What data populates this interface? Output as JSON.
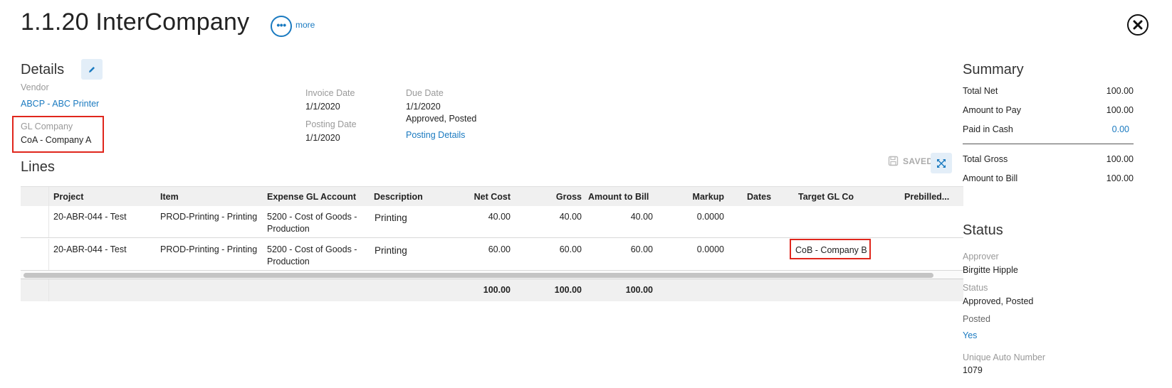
{
  "page": {
    "title": "1.1.20 InterCompany",
    "more_label": "more"
  },
  "details": {
    "heading": "Details",
    "vendor_label": "Vendor",
    "vendor_value": "ABCP - ABC Printer",
    "gl_company_label": "GL Company",
    "gl_company_value": "CoA - Company A",
    "invoice_date_label": "Invoice Date",
    "invoice_date_value": "1/1/2020",
    "posting_date_label": "Posting Date",
    "posting_date_value": "1/1/2020",
    "due_date_label": "Due Date",
    "due_date_value": "1/1/2020",
    "status_text": "Approved, Posted",
    "posting_details_link": "Posting Details"
  },
  "lines": {
    "heading": "Lines",
    "saved_label": "SAVED",
    "columns": [
      "Project",
      "Item",
      "Expense GL Account",
      "Description",
      "Net Cost",
      "Gross",
      "Amount to Bill",
      "Markup",
      "Dates",
      "Target GL Co",
      "Prebilled..."
    ],
    "rows": [
      {
        "project": "20-ABR-044 - Test",
        "item": "PROD-Printing - Printing",
        "expense_gl_line1": "5200 - Cost of Goods -",
        "expense_gl_line2": "Production",
        "description": "Printing",
        "net_cost": "40.00",
        "gross": "40.00",
        "amount_to_bill": "40.00",
        "markup": "0.0000",
        "dates": "",
        "target_gl_co": "",
        "prebilled": ""
      },
      {
        "project": "20-ABR-044 - Test",
        "item": "PROD-Printing - Printing",
        "expense_gl_line1": "5200 - Cost of Goods -",
        "expense_gl_line2": "Production",
        "description": "Printing",
        "net_cost": "60.00",
        "gross": "60.00",
        "amount_to_bill": "60.00",
        "markup": "0.0000",
        "dates": "",
        "target_gl_co": "CoB - Company B",
        "prebilled": ""
      }
    ],
    "totals": {
      "net_cost": "100.00",
      "gross": "100.00",
      "amount_to_bill": "100.00"
    }
  },
  "summary": {
    "heading": "Summary",
    "total_net_label": "Total Net",
    "total_net_value": "100.00",
    "amount_to_pay_label": "Amount to Pay",
    "amount_to_pay_value": "100.00",
    "paid_in_cash_label": "Paid in Cash",
    "paid_in_cash_value": "0.00",
    "total_gross_label": "Total Gross",
    "total_gross_value": "100.00",
    "amount_to_bill_label": "Amount to Bill",
    "amount_to_bill_value": "100.00"
  },
  "status": {
    "heading": "Status",
    "approver_label": "Approver",
    "approver_value": "Birgitte Hipple",
    "status_label": "Status",
    "status_value": "Approved, Posted",
    "posted_label": "Posted",
    "posted_value": "Yes",
    "auto_number_label": "Unique Auto Number",
    "auto_number_value": "1079"
  },
  "colors": {
    "accent": "#1a7ac0",
    "highlight_border": "#e0261c",
    "header_bg": "#f0f0f0",
    "button_bg": "#e3eef8"
  },
  "icons": [
    "more-icon",
    "close-icon",
    "pencil-icon",
    "save-icon",
    "expand-icon"
  ]
}
